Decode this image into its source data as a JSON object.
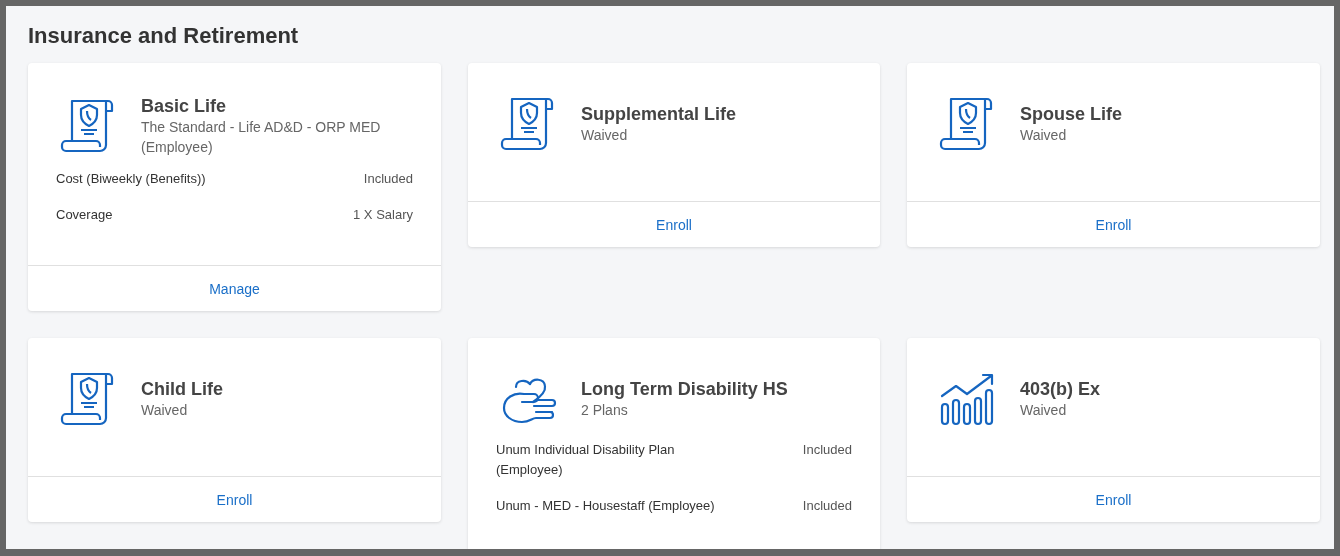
{
  "section_title": "Insurance and Retirement",
  "cards": [
    {
      "kind": "scroll",
      "title": "Basic Life",
      "subtitle": "The Standard - Life AD&D - ORP MED (Employee)",
      "details": [
        {
          "label": "Cost (Biweekly (Benefits))",
          "value": "Included"
        },
        {
          "label": "Coverage",
          "value": "1 X Salary"
        }
      ],
      "action": "Manage"
    },
    {
      "kind": "scroll",
      "title": "Supplemental Life",
      "subtitle": "Waived",
      "action": "Enroll"
    },
    {
      "kind": "scroll",
      "title": "Spouse Life",
      "subtitle": "Waived",
      "action": "Enroll"
    },
    {
      "kind": "scroll",
      "title": "Child Life",
      "subtitle": "Waived",
      "action": "Enroll"
    },
    {
      "kind": "hands",
      "title": "Long Term Disability HS",
      "subtitle": "2 Plans",
      "details": [
        {
          "label": "Unum Individual Disability Plan (Employee)",
          "value": "Included"
        },
        {
          "label": "Unum - MED - Housestaff (Employee)",
          "value": "Included"
        }
      ]
    },
    {
      "kind": "chart",
      "title": "403(b) Ex",
      "subtitle": "Waived",
      "action": "Enroll"
    }
  ]
}
